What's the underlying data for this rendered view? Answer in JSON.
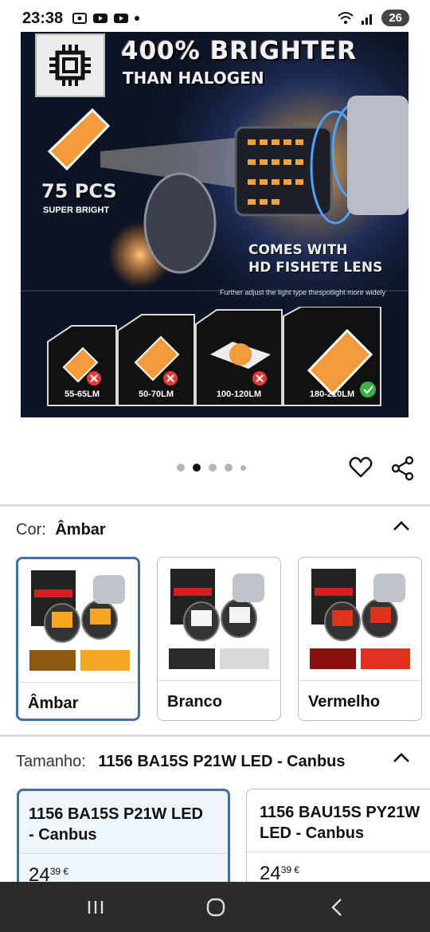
{
  "status_bar": {
    "time": "23:38",
    "left_icons": [
      "screen-record-icon",
      "youtube-icon",
      "youtube-icon",
      "dot-icon"
    ],
    "right_icons": [
      "wifi-icon",
      "signal-icon"
    ],
    "battery": "26"
  },
  "hero": {
    "headline": "400% BRIGHTER",
    "subheadline": "THAN HALOGEN",
    "pcs": "75 PCS",
    "pcs_sub": "SUPER BRIGHT",
    "lens_line1": "COMES WITH",
    "lens_line2": "HD FISHETE LENS",
    "note": "Further adjust the light type thespotlight more widely",
    "tiers": [
      "55-65LM",
      "50-70LM",
      "100-120LM",
      "180-210LM"
    ]
  },
  "carousel": {
    "count": 5,
    "active_index": 1
  },
  "actions": {
    "favorite_icon": "heart-icon",
    "share_icon": "share-icon"
  },
  "color": {
    "label": "Cor:",
    "selected": "Âmbar",
    "options": [
      {
        "label": "Âmbar",
        "accent": "#f5a623"
      },
      {
        "label": "Branco",
        "accent": "#e8e8e8"
      },
      {
        "label": "Vermelho",
        "accent": "#e0301e"
      }
    ]
  },
  "size": {
    "label": "Tamanho:",
    "selected": "1156 BA15S P21W LED - Canbus",
    "options": [
      {
        "line1": "1156 BA15S P21W LED",
        "line2": "- Canbus",
        "price_whole": "24",
        "price_fraction": "39",
        "currency": "€"
      },
      {
        "line1": "1156 BAU15S PY21W",
        "line2": "LED - Canbus",
        "price_whole": "24",
        "price_fraction": "39",
        "currency": "€"
      }
    ]
  },
  "colors": {
    "selected_border": "#3f6fa6",
    "amber": "#f5a623"
  }
}
